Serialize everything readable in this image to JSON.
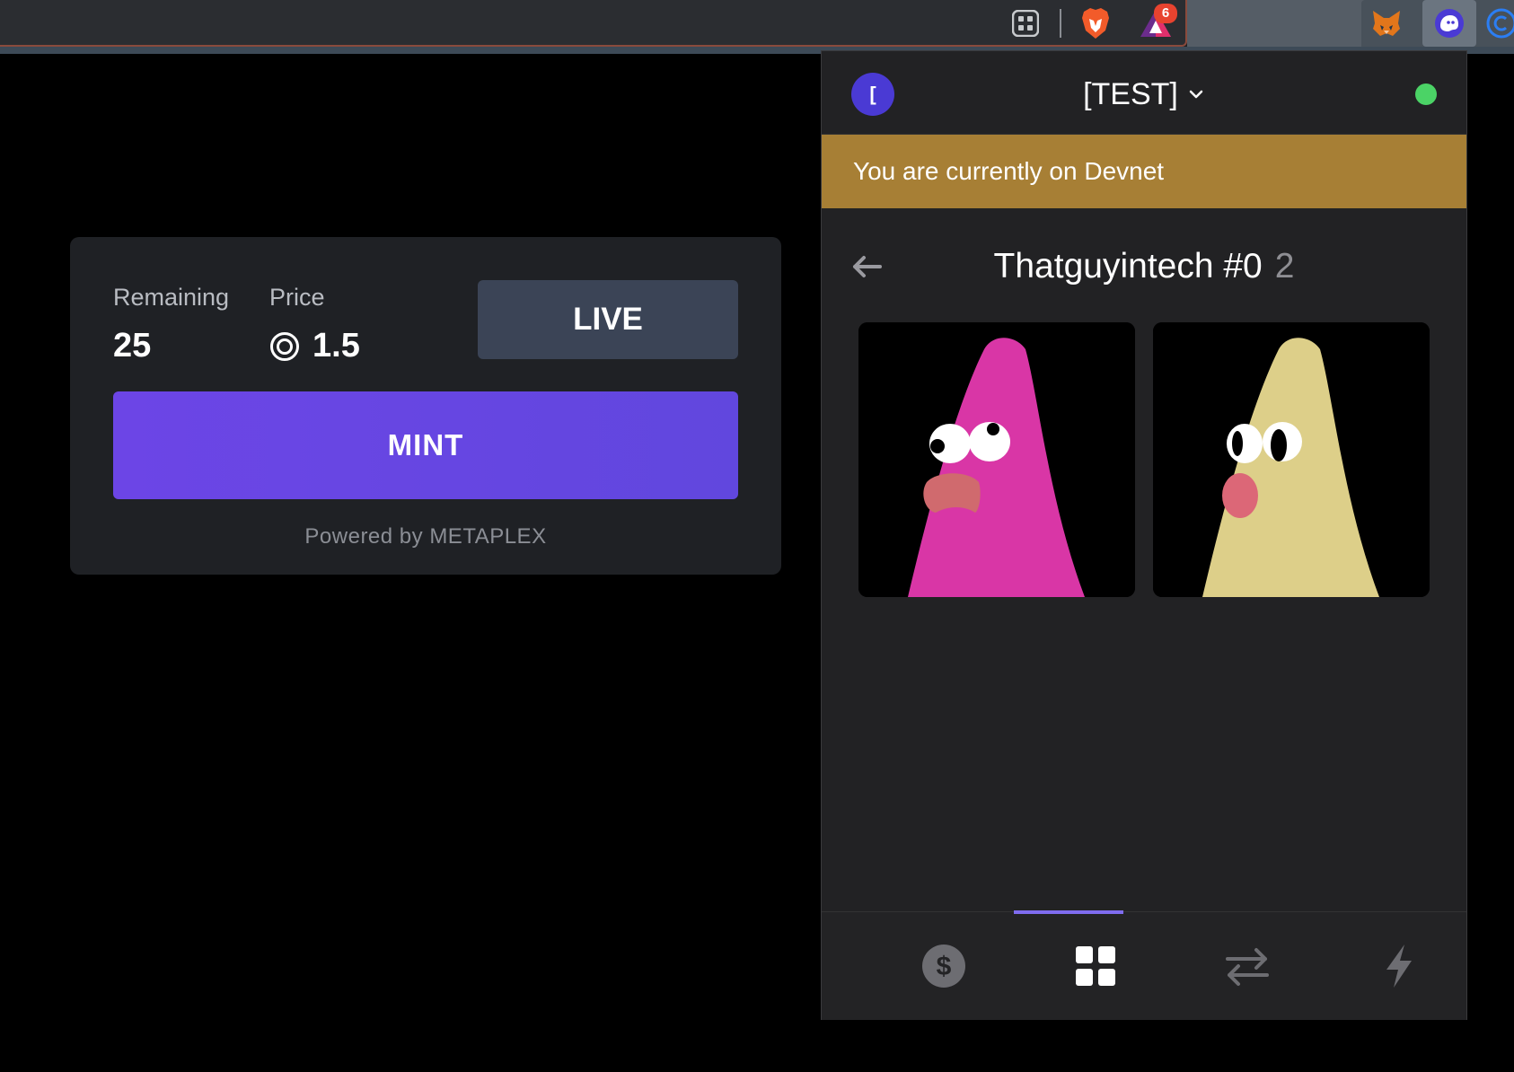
{
  "browser": {
    "extensions": {
      "rewards_badge": "6",
      "icons": [
        "grid-icon",
        "brave-lion-icon",
        "brave-rewards-icon",
        "metamask-fox-icon",
        "phantom-ghost-icon",
        "c-extension-icon"
      ]
    }
  },
  "mint_card": {
    "remaining_label": "Remaining",
    "remaining_value": "25",
    "price_label": "Price",
    "price_value": "1.5",
    "price_icon": "sol-circle-icon",
    "live_label": "LIVE",
    "mint_label": "MINT",
    "powered_by": "Powered by METAPLEX",
    "colors": {
      "card": "#1f2125",
      "mint_button": "#6147de",
      "live_button": "#3b4456"
    }
  },
  "wallet": {
    "account_initial": "[",
    "account_name": "[TEST]",
    "connection_status": "connected",
    "devnet_banner": "You are currently on Devnet",
    "collection": {
      "title": "Thatguyintech #0",
      "count": "2",
      "items": [
        {
          "color": "#d936a6",
          "alt": "pink-nft-character"
        },
        {
          "color": "#ddcf89",
          "alt": "yellow-nft-character"
        }
      ]
    },
    "nav": {
      "active": "collectibles",
      "items": [
        "balance-icon",
        "collectibles-grid-icon",
        "swap-arrows-icon",
        "activity-bolt-icon"
      ]
    },
    "colors": {
      "banner": "#a77f35",
      "accent": "#7f6cf0",
      "status": "#4bd366"
    }
  }
}
